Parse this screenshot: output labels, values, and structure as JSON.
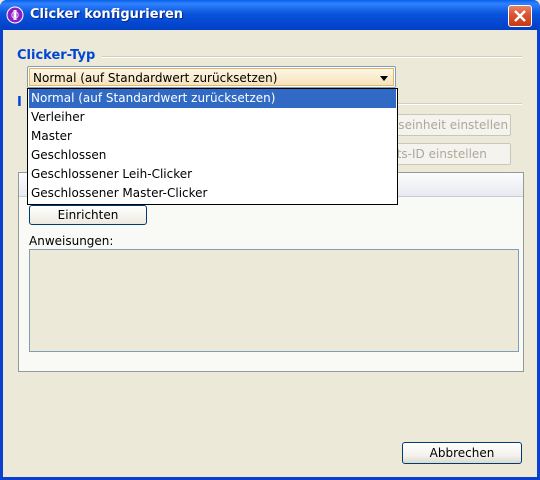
{
  "window": {
    "title": "Clicker konfigurieren"
  },
  "clicker_type": {
    "group_label": "Clicker-Typ",
    "selected": "Normal (auf Standardwert zurücksetzen)",
    "options": [
      "Normal (auf Standardwert zurücksetzen)",
      "Verleiher",
      "Master",
      "Geschlossen",
      "Geschlossener Leih-Clicker",
      "Geschlossener Master-Clicker"
    ]
  },
  "second_group": {
    "label_visible": "I"
  },
  "disabled_buttons": [
    "ntseinheit einstellen",
    "eits-ID einstellen"
  ],
  "setup": {
    "button_label": "Einrichten",
    "instructions_label": "Anweisungen:"
  },
  "footer": {
    "cancel_label": "Abbrechen"
  },
  "colors": {
    "group_label": "#0046d5",
    "selection": "#316ac5",
    "titlebar": "#0a55dc"
  }
}
